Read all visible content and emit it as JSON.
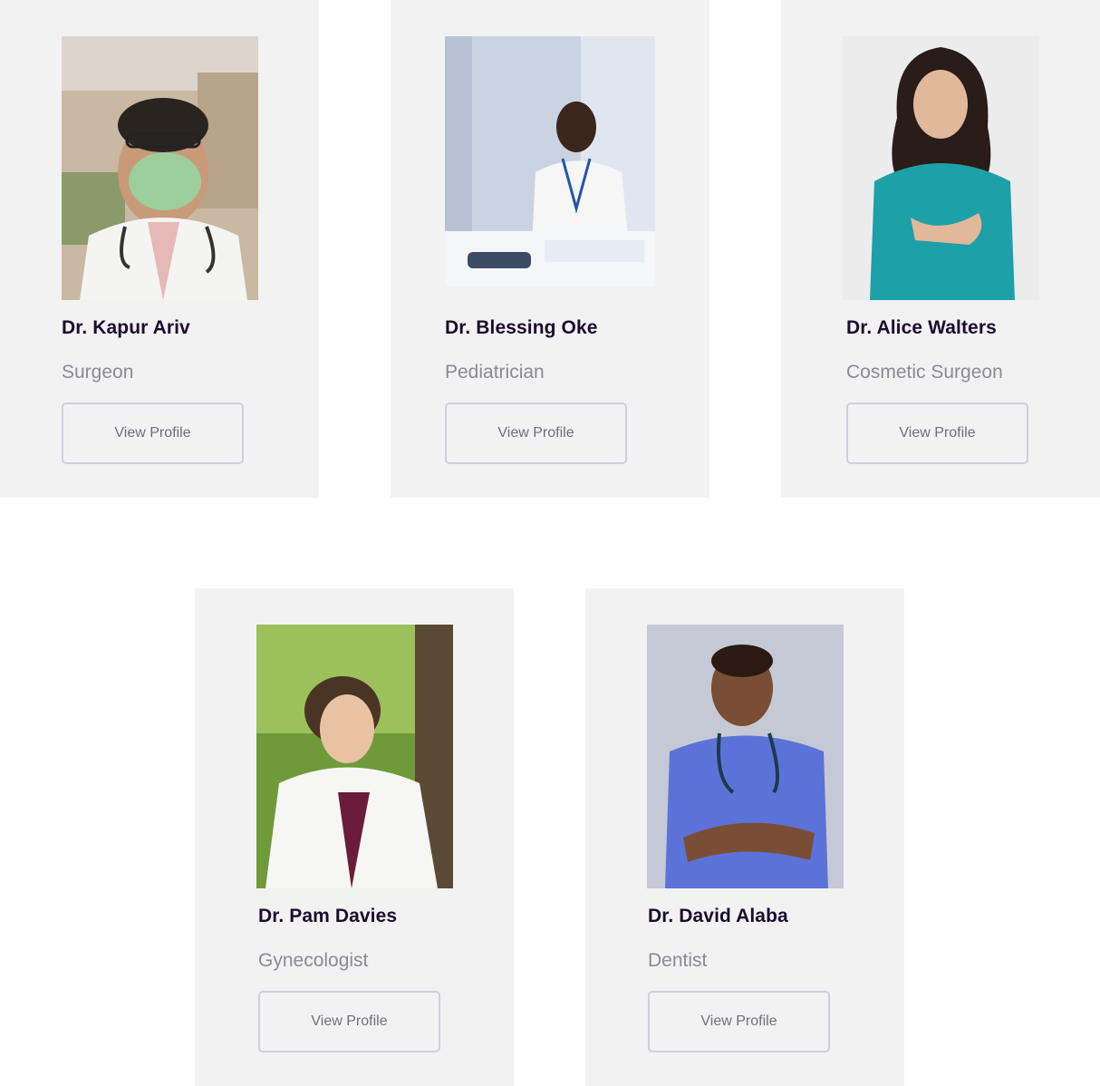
{
  "doctors": [
    {
      "name": "Dr. Kapur Ariv",
      "specialty": "Surgeon",
      "button_label": "View Profile"
    },
    {
      "name": "Dr. Blessing Oke",
      "specialty": "Pediatrician",
      "button_label": "View Profile"
    },
    {
      "name": "Dr. Alice Walters",
      "specialty": "Cosmetic Surgeon",
      "button_label": "View Profile"
    },
    {
      "name": "Dr. Pam Davies",
      "specialty": "Gynecologist",
      "button_label": "View Profile"
    },
    {
      "name": "Dr. David Alaba",
      "specialty": "Dentist",
      "button_label": "View Profile"
    }
  ],
  "colors": {
    "card_background": "#f2f2f2",
    "name_text": "#1b0d2e",
    "specialty_text": "#8a8a98",
    "button_border": "#cfcfdc"
  }
}
